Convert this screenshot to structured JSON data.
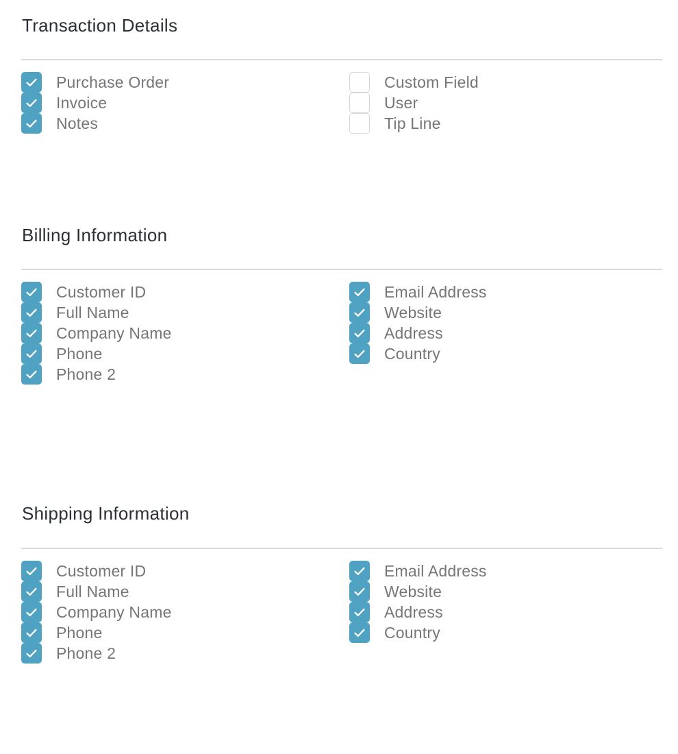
{
  "colors": {
    "checkbox_checked": "#4fa2c1",
    "checkbox_unchecked_border": "#d4d6d9",
    "title_text": "#2b2f36",
    "label_text": "#757679",
    "divider": "#d9dadc"
  },
  "sections": [
    {
      "title": "Transaction Details",
      "left": [
        {
          "label": "Purchase Order",
          "checked": true
        },
        {
          "label": "Invoice",
          "checked": true
        },
        {
          "label": "Notes",
          "checked": true
        }
      ],
      "right": [
        {
          "label": "Custom Field",
          "checked": false
        },
        {
          "label": "User",
          "checked": false
        },
        {
          "label": "Tip Line",
          "checked": false
        }
      ]
    },
    {
      "title": "Billing Information",
      "left": [
        {
          "label": "Customer ID",
          "checked": true
        },
        {
          "label": "Full Name",
          "checked": true
        },
        {
          "label": "Company Name",
          "checked": true
        },
        {
          "label": "Phone",
          "checked": true
        },
        {
          "label": "Phone 2",
          "checked": true
        }
      ],
      "right": [
        {
          "label": "Email Address",
          "checked": true
        },
        {
          "label": "Website",
          "checked": true
        },
        {
          "label": "Address",
          "checked": true
        },
        {
          "label": "Country",
          "checked": true
        }
      ]
    },
    {
      "title": "Shipping Information",
      "left": [
        {
          "label": "Customer ID",
          "checked": true
        },
        {
          "label": "Full Name",
          "checked": true
        },
        {
          "label": "Company Name",
          "checked": true
        },
        {
          "label": "Phone",
          "checked": true
        },
        {
          "label": "Phone 2",
          "checked": true
        }
      ],
      "right": [
        {
          "label": "Email Address",
          "checked": true
        },
        {
          "label": "Website",
          "checked": true
        },
        {
          "label": "Address",
          "checked": true
        },
        {
          "label": "Country",
          "checked": true
        }
      ]
    }
  ]
}
